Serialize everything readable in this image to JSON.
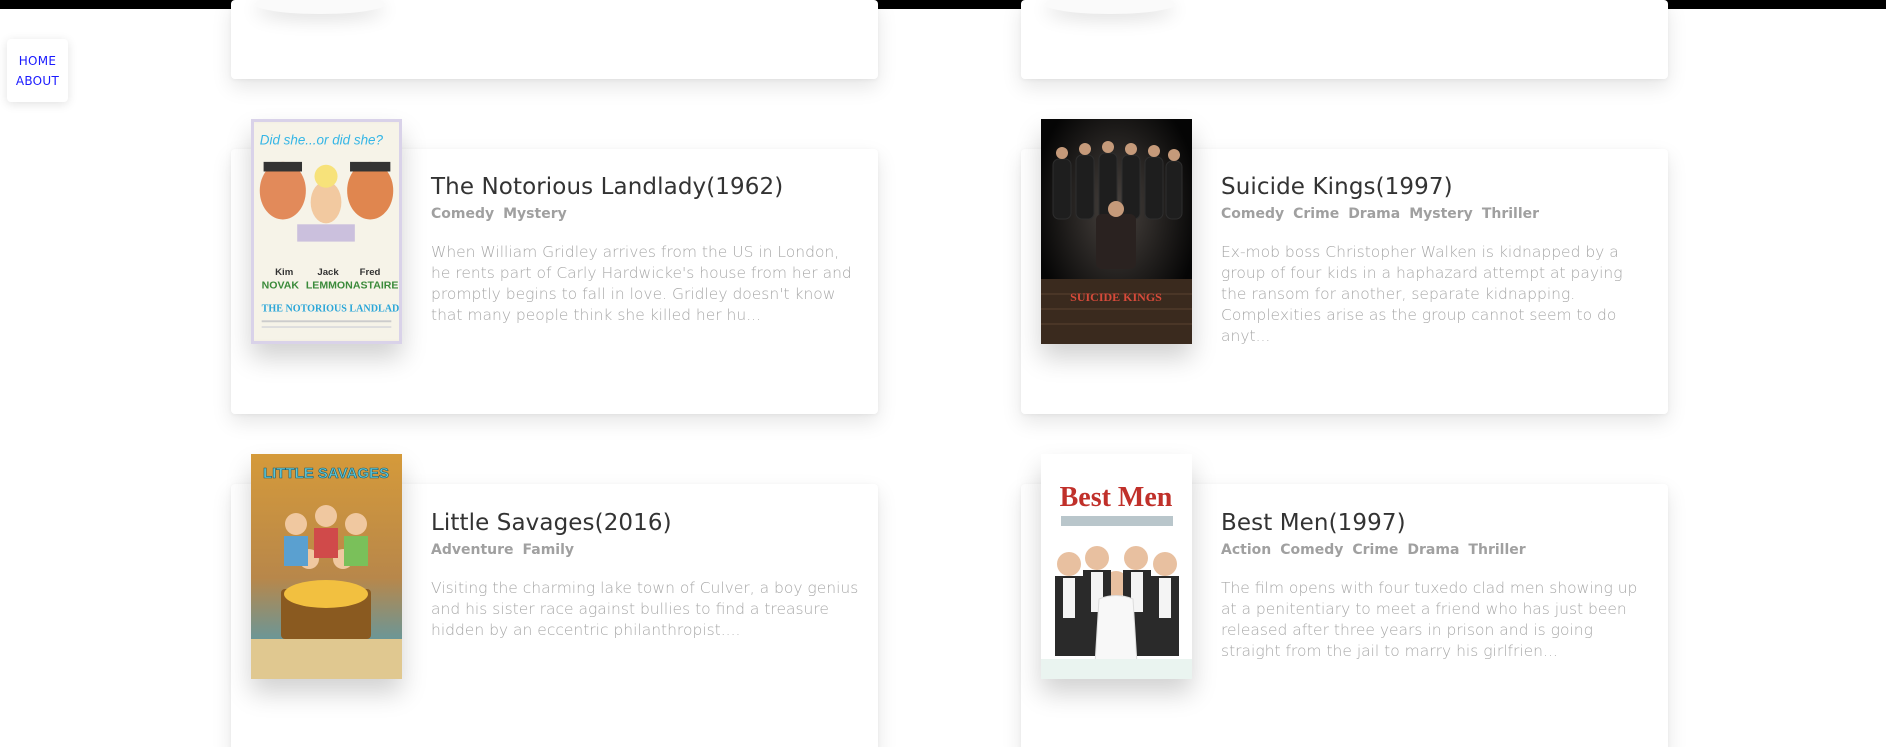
{
  "nav": {
    "home": "HOME",
    "about": "ABOUT"
  },
  "movies": [
    {
      "title": "The Notorious Landlady(1962)",
      "genres": [
        "Comedy",
        "Mystery"
      ],
      "summary": "When William Gridley arrives from the US in London, he rents part of Carly Hardwicke's house from her and promptly begins to fall in love. Gridley doesn't know that many people think she killed her hu...",
      "poster_text": [
        "Did she...or did she?",
        "Kim",
        "Jack",
        "Fred",
        "NOVAK",
        "LEMMON",
        "ASTAIRE",
        "THE NOTORIOUS LANDLADY"
      ]
    },
    {
      "title": "Suicide Kings(1997)",
      "genres": [
        "Comedy",
        "Crime",
        "Drama",
        "Mystery",
        "Thriller"
      ],
      "summary": "Ex-mob boss Christopher Walken is kidnapped by a group of four kids in a haphazard attempt at paying the ransom for another, separate kidnapping. Complexities arise as the group cannot seem to do anyt...",
      "poster_text": [
        "SUICIDE KINGS"
      ]
    },
    {
      "title": "Little Savages(2016)",
      "genres": [
        "Adventure",
        "Family"
      ],
      "summary": "Visiting the charming lake town of Culver, a boy genius and his sister race against bullies to find a treasure hidden by an eccentric philanthropist....",
      "poster_text": [
        "LITTLE SAVAGES"
      ]
    },
    {
      "title": "Best Men(1997)",
      "genres": [
        "Action",
        "Comedy",
        "Crime",
        "Drama",
        "Thriller"
      ],
      "summary": "The film opens with four tuxedo clad men showing up at a penitentiary to meet a friend who has just been released after three years in prison and is going straight from the jail to marry his girlfrien...",
      "poster_text": [
        "Best Men"
      ]
    }
  ]
}
